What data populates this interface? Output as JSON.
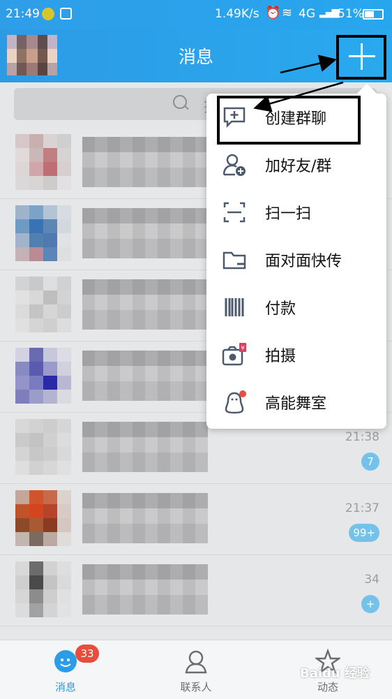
{
  "status_bar": {
    "time": "21:49",
    "speed": "1.49K/s",
    "network": "4G",
    "battery": "51%",
    "icons": [
      "app-icon",
      "scanner-icon",
      "alarm-icon",
      "wifi-icon",
      "signal-icon",
      "battery-icon"
    ]
  },
  "header": {
    "title": "消息",
    "add_icon": "plus-icon"
  },
  "search": {
    "placeholder": "搜",
    "icon": "search-icon"
  },
  "conversations": [
    {
      "time": "",
      "badge": ""
    },
    {
      "time": "",
      "badge": ""
    },
    {
      "time": "",
      "badge": ""
    },
    {
      "time": "",
      "badge": ""
    },
    {
      "time": "21:38",
      "badge": "7"
    },
    {
      "time": "21:37",
      "badge": "99+"
    },
    {
      "time": "34",
      "badge": "+"
    }
  ],
  "menu": {
    "items": [
      {
        "label": "创建群聊",
        "icon": "create-group-chat-icon"
      },
      {
        "label": "加好友/群",
        "icon": "add-friend-icon"
      },
      {
        "label": "扫一扫",
        "icon": "scan-icon"
      },
      {
        "label": "面对面快传",
        "icon": "folder-icon"
      },
      {
        "label": "付款",
        "icon": "barcode-icon"
      },
      {
        "label": "拍摄",
        "icon": "camera-icon"
      },
      {
        "label": "高能舞室",
        "icon": "penguin-icon"
      }
    ]
  },
  "tabbar": {
    "tabs": [
      {
        "label": "消息",
        "badge": "33",
        "icon": "message-bubble-icon"
      },
      {
        "label": "联系人",
        "icon": "contacts-icon"
      },
      {
        "label": "动态",
        "icon": "star-icon"
      }
    ]
  },
  "watermark": "Baidu 经验",
  "colors": {
    "header_blue": "#2aa3ec",
    "badge_red": "#e94b3c",
    "unread_badge": "#74c2ea",
    "menu_icon": "#4d5a6e"
  }
}
